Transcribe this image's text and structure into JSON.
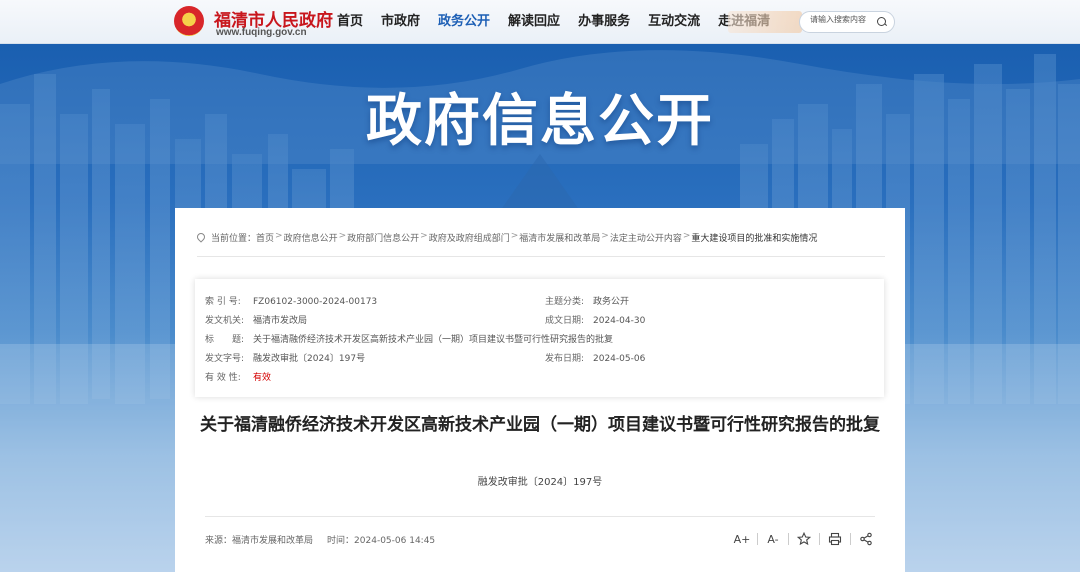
{
  "header": {
    "site_name": "福清市人民政府",
    "site_url": "www.fuqing.gov.cn",
    "nav": [
      {
        "label": "首页",
        "active": false
      },
      {
        "label": "市政府",
        "active": false
      },
      {
        "label": "政务公开",
        "active": true
      },
      {
        "label": "解读回应",
        "active": false
      },
      {
        "label": "办事服务",
        "active": false
      },
      {
        "label": "互动交流",
        "active": false
      },
      {
        "label": "走进福清",
        "active": false
      }
    ],
    "search_placeholder": "请输入搜索内容",
    "accent_color": "#1d5fb5",
    "brand_color": "#c8161d"
  },
  "banner": {
    "title": "政府信息公开"
  },
  "breadcrumb": {
    "prefix": "当前位置：",
    "items": [
      "首页",
      "政府信息公开",
      "政府部门信息公开",
      "政府及政府组成部门",
      "福清市发展和改革局",
      "法定主动公开内容",
      "重大建设项目的批准和实施情况"
    ],
    "separator": ">"
  },
  "meta": {
    "index_label": "索 引 号:",
    "index_value": "FZ06102-3000-2024-00173",
    "topic_label": "主题分类:",
    "topic_value": "政务公开",
    "issuer_label": "发文机关:",
    "issuer_value": "福清市发改局",
    "created_label": "成文日期:",
    "created_value": "2024-04-30",
    "title_label": "标　　题:",
    "title_value": "关于福清融侨经济技术开发区高新技术产业园（一期）项目建议书暨可行性研究报告的批复",
    "docno_label": "发文字号:",
    "docno_value": "融发改审批〔2024〕197号",
    "published_label": "发布日期:",
    "published_value": "2024-05-06",
    "validity_label": "有 效 性:",
    "validity_value": "有效",
    "validity_color": "#d40000"
  },
  "article": {
    "title": "关于福清融侨经济技术开发区高新技术产业园（一期）项目建议书暨可行性研究报告的批复",
    "doc_number": "融发改审批〔2024〕197号",
    "source_label": "来源：",
    "source_value": "福清市发展和改革局",
    "time_label": "时间：",
    "time_value": "2024-05-06 14:45"
  },
  "tools": {
    "font_increase": "A+",
    "font_decrease": "A-",
    "icons": [
      "font-increase-icon",
      "font-decrease-icon",
      "star-icon",
      "print-icon",
      "share-icon"
    ]
  }
}
